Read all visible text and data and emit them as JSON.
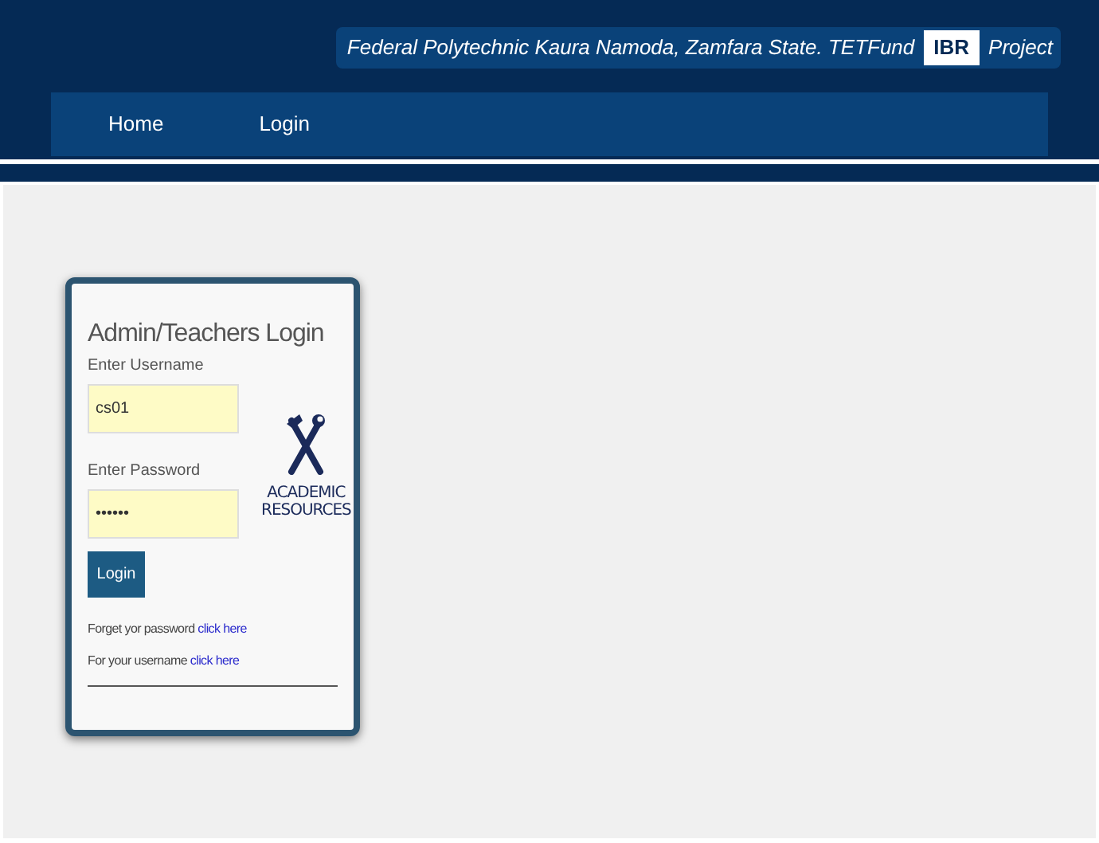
{
  "banner": {
    "text": "Federal Polytechnic Kaura Namoda, Zamfara State. TETFund",
    "badge": "IBR",
    "suffix": "Project"
  },
  "nav": [
    {
      "label": "Home"
    },
    {
      "label": "Login"
    }
  ],
  "login": {
    "title": "Admin/Teachers Login",
    "fields": [
      {
        "label": "Enter Username",
        "value": "cs01"
      },
      {
        "label": "Enter Password",
        "value": "••••••"
      }
    ],
    "button": "Login",
    "help": [
      {
        "text": "Forget yor password",
        "link": "click here"
      },
      {
        "text": "For your username",
        "link": "click here"
      }
    ],
    "logo": {
      "lines": [
        "ACADEMIC",
        "RESOURCES"
      ]
    }
  }
}
